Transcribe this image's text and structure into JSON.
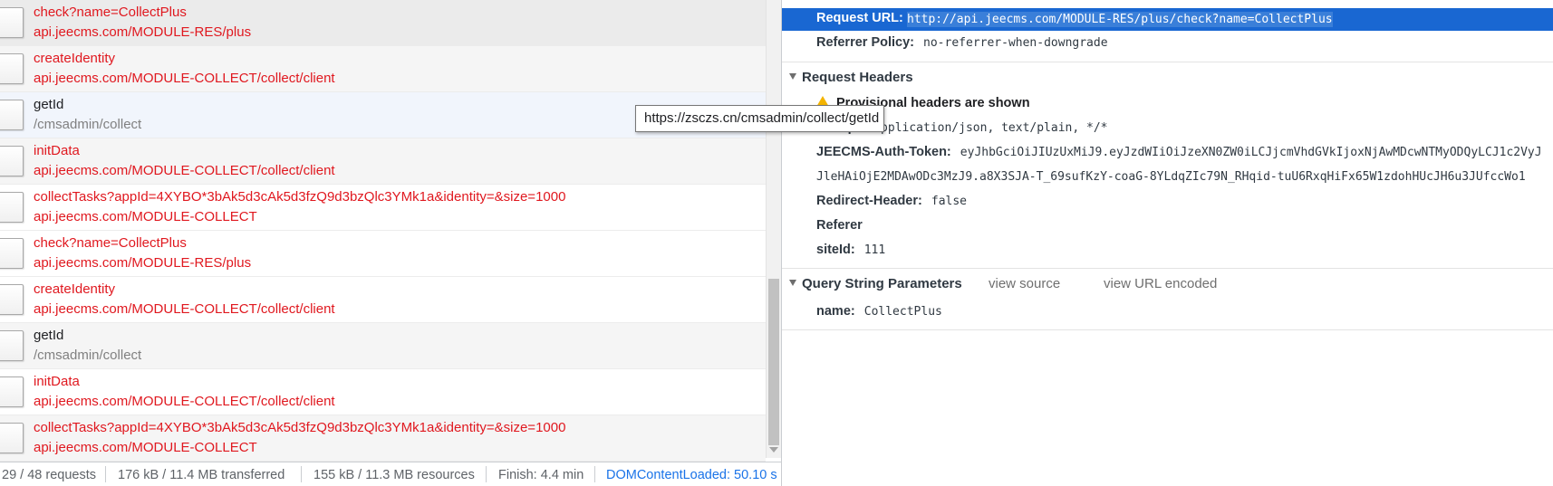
{
  "requests": [
    {
      "name": "check?name=CollectPlus",
      "path": "api.jeecms.com/MODULE-RES/plus",
      "status": "error",
      "state": "selected"
    },
    {
      "name": "createIdentity",
      "path": "api.jeecms.com/MODULE-COLLECT/collect/client",
      "status": "error",
      "state": "zebra"
    },
    {
      "name": "getId",
      "path": "/cmsadmin/collect",
      "status": "normal",
      "state": "hover"
    },
    {
      "name": "initData",
      "path": "api.jeecms.com/MODULE-COLLECT/collect/client",
      "status": "error",
      "state": "zebra"
    },
    {
      "name": "collectTasks?appId=4XYBO*3bAk5d3cAk5d3fzQ9d3bzQlc3YMk1a&identity=&size=1000",
      "path": "api.jeecms.com/MODULE-COLLECT",
      "status": "error",
      "state": "plain"
    },
    {
      "name": "check?name=CollectPlus",
      "path": "api.jeecms.com/MODULE-RES/plus",
      "status": "error",
      "state": "plain"
    },
    {
      "name": "createIdentity",
      "path": "api.jeecms.com/MODULE-COLLECT/collect/client",
      "status": "error",
      "state": "plain"
    },
    {
      "name": "getId",
      "path": "/cmsadmin/collect",
      "status": "normal",
      "state": "zebra"
    },
    {
      "name": "initData",
      "path": "api.jeecms.com/MODULE-COLLECT/collect/client",
      "status": "error",
      "state": "plain"
    },
    {
      "name": "collectTasks?appId=4XYBO*3bAk5d3cAk5d3fzQ9d3bzQlc3YMk1a&identity=&size=1000",
      "path": "api.jeecms.com/MODULE-COLLECT",
      "status": "error",
      "state": "zebra"
    }
  ],
  "summary": {
    "requests": "29 / 48 requests",
    "transferred": "176 kB / 11.4 MB transferred",
    "resources": "155 kB / 11.3 MB resources",
    "finish": "Finish: 4.4 min",
    "dcl": "DOMContentLoaded: 50.10 s"
  },
  "tooltip": "https://zsczs.cn/cmsadmin/collect/getId",
  "general": {
    "request_url_key": "Request URL:",
    "request_url_value": "http://api.jeecms.com/MODULE-RES/plus/check?name=CollectPlus",
    "referrer_policy_key": "Referrer Policy:",
    "referrer_policy_value": "no-referrer-when-downgrade"
  },
  "request_headers": {
    "title": "Request Headers",
    "warning": "Provisional headers are shown",
    "accept_key": "Accept:",
    "accept_value": "application/json, text/plain, */*",
    "token_key": "JEECMS-Auth-Token:",
    "token_value_line1": "eyJhbGciOiJIUzUxMiJ9.eyJzdWIiOiJzeXN0ZW0iLCJjcmVhdGVkIjoxNjAwMDcwNTMyODQyLCJ1c2VyJ",
    "token_value_line2": "JleHAiOjE2MDAwODc3MzJ9.a8X3SJA-T_69sufKzY-coaG-8YLdqZIc79N_RHqid-tuU6RxqHiFx65W1zdohHUcJH6u3JUfccWo1",
    "redirect_key": "Redirect-Header:",
    "redirect_value": "false",
    "referer_key": "Referer",
    "siteid_key": "siteId:",
    "siteid_value": "111"
  },
  "query_params": {
    "title": "Query String Parameters",
    "view_source": "view source",
    "view_url_encoded": "view URL encoded",
    "name_key": "name:",
    "name_value": "CollectPlus"
  },
  "colors": {
    "error": "#e0181f",
    "selection": "#1967d2",
    "link": "#1a73e8"
  }
}
